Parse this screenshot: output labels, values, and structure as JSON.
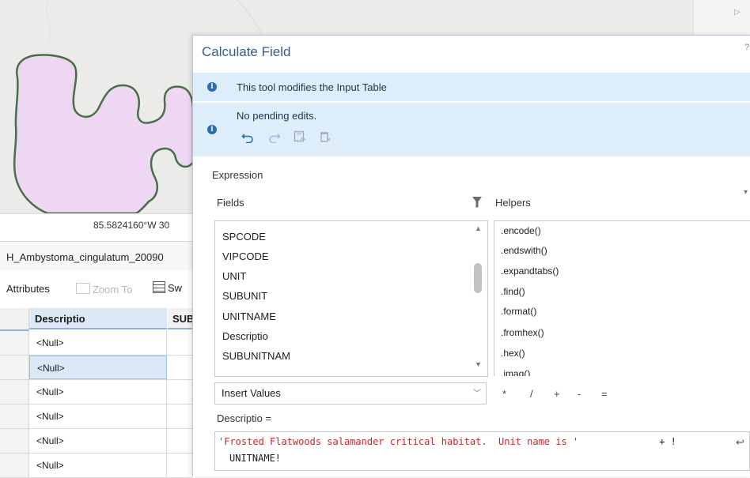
{
  "map": {
    "coordinate": "85.5824160°W 30",
    "polygon_fill": "#eed7f2",
    "polygon_stroke": "#4a6e49"
  },
  "table": {
    "title": "H_Ambystoma_cingulatum_20090",
    "toolbar": {
      "attributes": "Attributes",
      "zoom_to": "Zoom To",
      "switch": "Sw"
    },
    "columns": [
      "Descriptio",
      "SUB"
    ],
    "rows": [
      "<Null>",
      "<Null>",
      "<Null>",
      "<Null>",
      "<Null>",
      "<Null>"
    ],
    "selected_row_index": 1
  },
  "dialog": {
    "title": "Calculate Field",
    "banner_info": "This tool modifies the Input Table",
    "banner_edits": "No pending edits.",
    "expression_label": "Expression",
    "fields_label": "Fields",
    "helpers_label": "Helpers",
    "fields": [
      "SPCODE",
      "VIPCODE",
      "UNIT",
      "SUBUNIT",
      "UNITNAME",
      "Descriptio",
      "SUBUNITNAM"
    ],
    "helpers": [
      ".encode()",
      ".endswith()",
      ".expandtabs()",
      ".find()",
      ".format()",
      ".fromhex()",
      ".hex()",
      ".imag()"
    ],
    "insert_values": "Insert Values",
    "operators": [
      "*",
      "/",
      "+",
      "-",
      "="
    ],
    "target_field_label": "Descriptio =",
    "expression_string": "'Frosted Flatwoods salamander critical habitat.  Unit name is '",
    "expression_op": " + !",
    "expression_line2": "UNITNAME!",
    "accent_color": "#2b6cb3",
    "banner_color": "#ddedf9"
  }
}
